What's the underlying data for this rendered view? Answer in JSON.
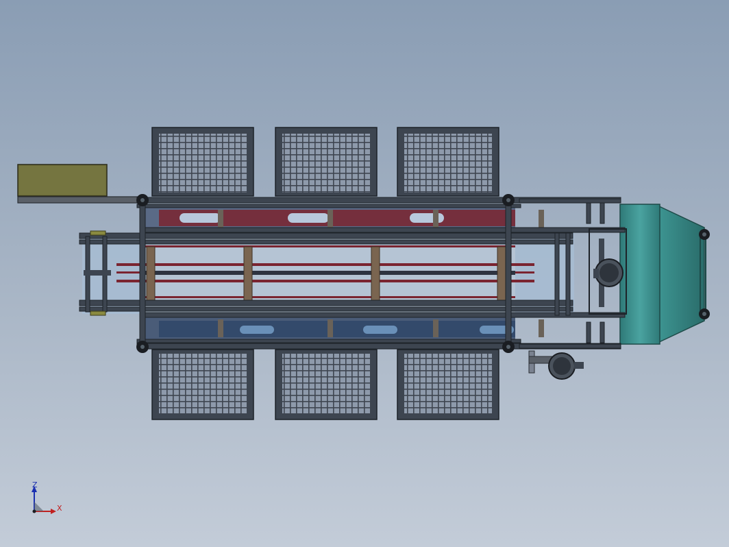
{
  "view": {
    "background_top": "#8a9db4",
    "background_bottom": "#c3ccd8"
  },
  "model": {
    "frame_color": "#3d4550",
    "mesh_color": "#5b6470",
    "conveyor_red": "#7a2430",
    "conveyor_blue": "#3a5a80",
    "hopper_color": "#3f8f8c",
    "control_box_color": "#6e6e3a",
    "roller_color": "#7a6550",
    "caster_color": "#1a1d22"
  },
  "triad": {
    "z_label": "Z",
    "x_label": "X",
    "z_color": "#1a2fb0",
    "x_color": "#c02020"
  }
}
